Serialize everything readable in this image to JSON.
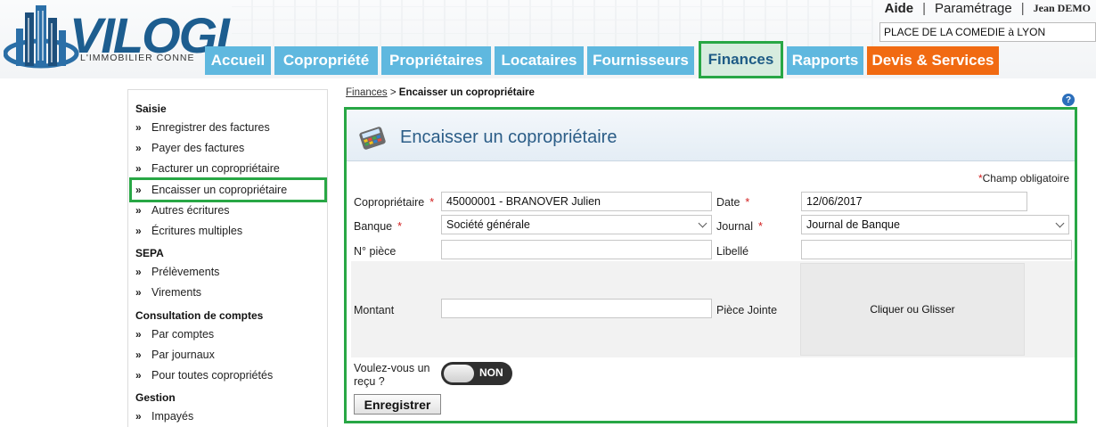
{
  "brand": {
    "name": "VILOGI",
    "tagline": "L'IMMOBILIER CONNE"
  },
  "top_links": {
    "help": "Aide",
    "separator": "|",
    "settings": "Paramétrage",
    "user": "Jean DEMO"
  },
  "site_selector": {
    "value": "PLACE DE LA COMEDIE à LYON"
  },
  "nav": {
    "tabs": [
      {
        "label": "Accueil"
      },
      {
        "label": "Copropriété"
      },
      {
        "label": "Propriétaires"
      },
      {
        "label": "Locataires"
      },
      {
        "label": "Fournisseurs"
      },
      {
        "label": "Finances",
        "active": true
      },
      {
        "label": "Rapports"
      },
      {
        "label": "Devis & Services"
      }
    ]
  },
  "sidebar": {
    "chevron": "»",
    "sections": {
      "saisie": "Saisie",
      "sepa": "SEPA",
      "consultation": "Consultation de comptes",
      "gestion": "Gestion"
    },
    "items": {
      "enregistrer_factures": "Enregistrer des factures",
      "payer_factures": "Payer des factures",
      "facturer": "Facturer un copropriétaire",
      "encaisser": "Encaisser un copropriétaire",
      "autres": "Autres écritures",
      "multiples": "Écritures multiples",
      "prelevements": "Prélèvements",
      "virements": "Virements",
      "par_comptes": "Par comptes",
      "par_journaux": "Par journaux",
      "toutes": "Pour toutes copropriétés",
      "impayes": "Impayés"
    }
  },
  "breadcrumb": {
    "parent": "Finances",
    "separator": ">",
    "current": "Encaisser un copropriétaire"
  },
  "help_icon": "?",
  "form": {
    "title": "Encaisser un copropriétaire",
    "required_marker": "*",
    "required_note": "Champ obligatoire",
    "coproprietaire": {
      "label": "Copropriétaire",
      "value": "45000001 - BRANOVER Julien"
    },
    "date": {
      "label": "Date",
      "value": "12/06/2017"
    },
    "banque": {
      "label": "Banque",
      "value": "Société générale"
    },
    "journal": {
      "label": "Journal",
      "value": "Journal de Banque"
    },
    "piece": {
      "label": "N° pièce",
      "value": ""
    },
    "libelle": {
      "label": "Libellé",
      "value": ""
    },
    "montant": {
      "label": "Montant",
      "value": ""
    },
    "piece_jointe": {
      "label": "Pièce Jointe",
      "dropzone": "Cliquer ou Glisser"
    },
    "recu": {
      "label_line1": "Voulez-vous un",
      "label_line2": "reçu ?",
      "toggle": "NON"
    },
    "save_button": "Enregistrer"
  }
}
